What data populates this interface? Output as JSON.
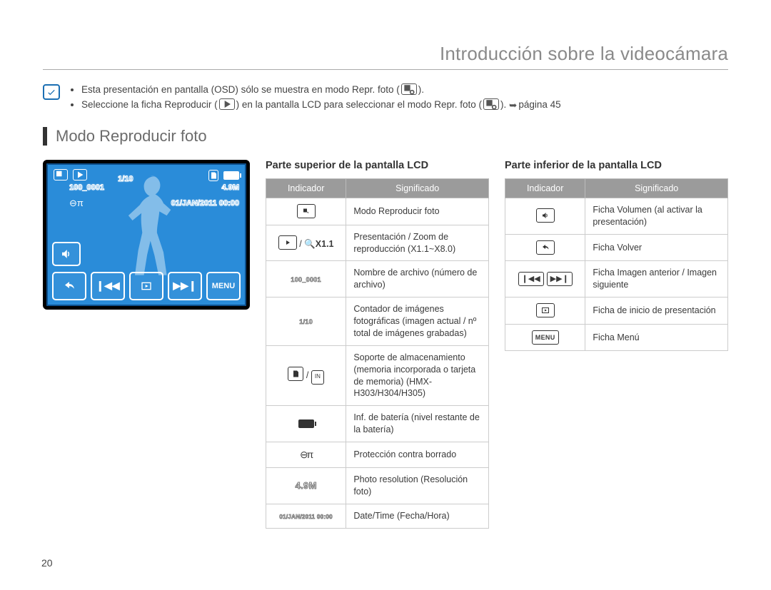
{
  "page_title": "Introducción sobre la videocámara",
  "note": {
    "line1_pre": "Esta presentación en pantalla (OSD) sólo se muestra en modo Repr. foto (",
    "line1_post": ").",
    "line2_pre": "Seleccione la ficha Reproducir (",
    "line2_mid": ") en la pantalla LCD para seleccionar el modo Repr. foto (",
    "line2_post": "). ",
    "pageref": "página 45"
  },
  "section": "Modo Reproducir foto",
  "lcd": {
    "counter": "1/10",
    "filename": "100_0001",
    "resolution": "4.9M",
    "datetime": "01/JAN/2011 00:00",
    "menu": "MENU"
  },
  "upper": {
    "title": "Parte superior de la pantalla LCD",
    "th1": "Indicador",
    "th2": "Significado",
    "rows": [
      {
        "lbl": "photo-play-icon",
        "txt": "Modo Reproducir foto"
      },
      {
        "lbl": "zoom",
        "txt": "Presentación / Zoom de reproducción (X1.1~X8.0)"
      },
      {
        "lbl": "filename",
        "txt": "Nombre de archivo (número de archivo)"
      },
      {
        "lbl": "counter",
        "txt": "Contador de imágenes fotográficas (imagen actual / nº total de imágenes grabadas)"
      },
      {
        "lbl": "storage",
        "txt": "Soporte de almacenamiento (memoria incorporada o tarjeta de memoria) (HMX-H303/H304/H305)"
      },
      {
        "lbl": "battery",
        "txt": "Inf. de batería (nivel restante de la batería)"
      },
      {
        "lbl": "protect",
        "txt": "Protección contra borrado"
      },
      {
        "lbl": "resolution",
        "txt": "Photo resolution (Resolución foto)"
      },
      {
        "lbl": "datetime",
        "txt": "Date/Time (Fecha/Hora)"
      }
    ],
    "zoom_text": "X1.1",
    "filename_ind": "100_0001",
    "counter_ind": "1/10",
    "resolution_ind": "4.9M",
    "datetime_ind": "01/JAN/2011 00:00"
  },
  "lower": {
    "title": "Parte inferior de la pantalla LCD",
    "th1": "Indicador",
    "th2": "Significado",
    "rows": [
      {
        "lbl": "volume",
        "txt": "Ficha Volumen (al activar la presentación)"
      },
      {
        "lbl": "back",
        "txt": "Ficha Volver"
      },
      {
        "lbl": "prevnext",
        "txt": "Ficha Imagen anterior / Imagen siguiente"
      },
      {
        "lbl": "slideshow",
        "txt": "Ficha de inicio de presentación"
      },
      {
        "lbl": "menu",
        "txt": "Ficha Menú"
      }
    ],
    "menu_label": "MENU"
  },
  "page_number": "20"
}
